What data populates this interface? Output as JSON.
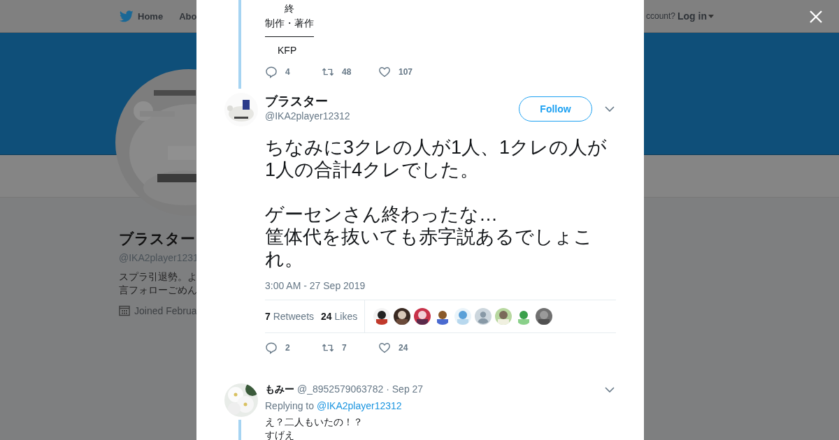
{
  "nav": {
    "items": [
      {
        "label": "Home"
      },
      {
        "label": "Abo"
      }
    ],
    "account_prompt": "ccount?",
    "login": "Log in"
  },
  "profile": {
    "name": "ブラスター",
    "handle": "@IKA2player1231",
    "bio": [
      "スプラ引退勢。よ",
      "言フォローごめん"
    ],
    "joined": "Joined Februa"
  },
  "thread_top": {
    "lines": [
      "終",
      "制作・著作"
    ],
    "credit": "KFP",
    "replies": "4",
    "retweets": "48",
    "likes": "107"
  },
  "tweet": {
    "name": "ブラスター",
    "handle": "@IKA2player12312",
    "follow": "Follow",
    "paragraphs": [
      {
        "lines": [
          "ちなみに3クレの人が1人、1クレの人が1人の合計4クレでした。"
        ]
      },
      {
        "lines": [
          "ゲーセンさん終わったな…",
          "筐体代を抜いても赤字説あるでしょこれ。"
        ]
      }
    ],
    "time": "3:00 AM - 27 Sep 2019",
    "retweet_count": "7",
    "retweet_label": "Retweets",
    "like_count": "24",
    "like_label": "Likes",
    "likers": [
      {
        "kind": "picture"
      },
      {
        "kind": "picture"
      },
      {
        "kind": "picture"
      },
      {
        "kind": "picture"
      },
      {
        "kind": "picture"
      },
      {
        "kind": "default"
      },
      {
        "kind": "picture"
      },
      {
        "kind": "picture"
      },
      {
        "kind": "picture"
      }
    ],
    "replies": "2",
    "retweets": "7",
    "likes": "24"
  },
  "reply": {
    "name": "もみー",
    "handle": "@_8952579063782",
    "date": "· Sep 27",
    "replying_to": "Replying to",
    "mention": "@IKA2player12312",
    "lines": [
      "え？二人もいたの！？",
      "すげえ"
    ]
  }
}
